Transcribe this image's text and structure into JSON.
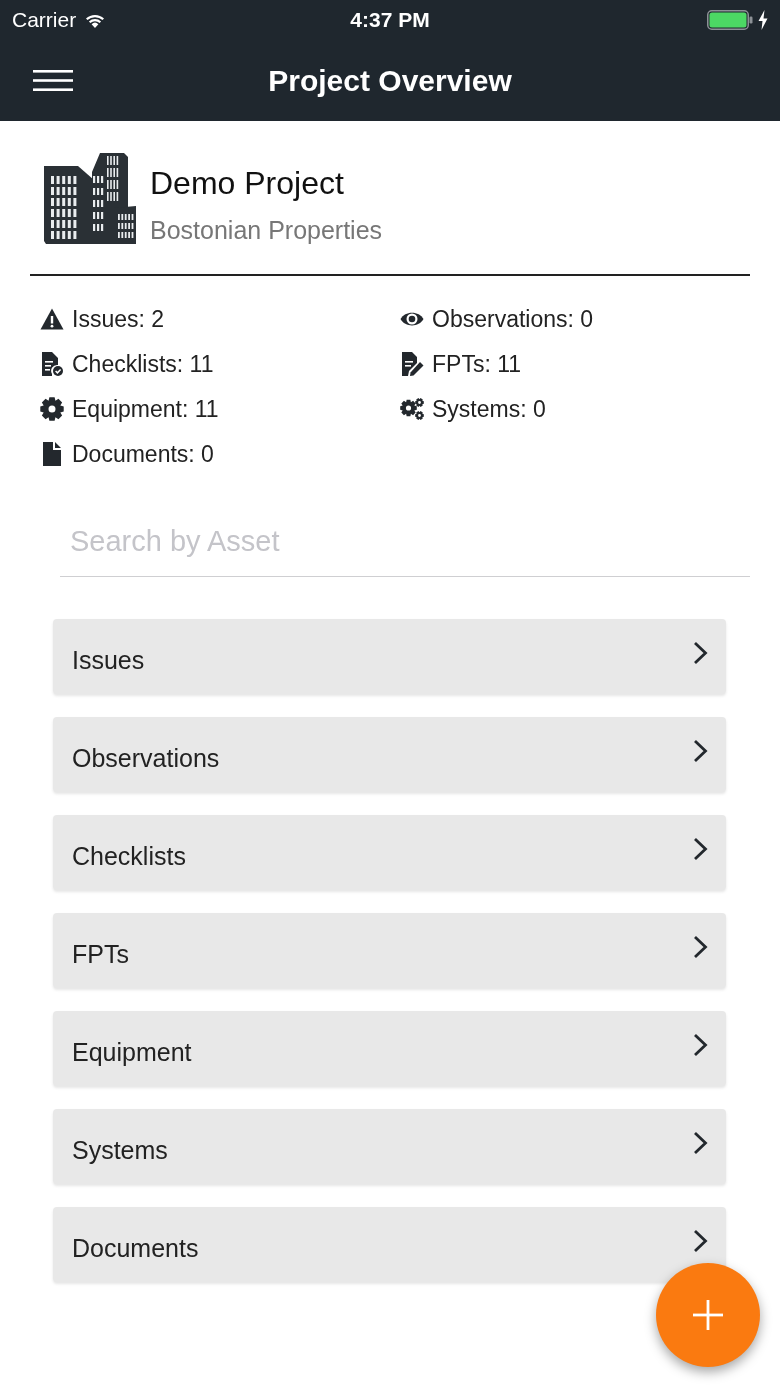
{
  "status_bar": {
    "carrier": "Carrier",
    "time": "4:37 PM"
  },
  "nav_bar": {
    "title": "Project Overview"
  },
  "project": {
    "name": "Demo Project",
    "company": "Bostonian Properties"
  },
  "stats": [
    {
      "kind": "warning",
      "label": "Issues: 2"
    },
    {
      "kind": "eye",
      "label": "Observations: 0"
    },
    {
      "kind": "checklist",
      "label": "Checklists: 11"
    },
    {
      "kind": "edit",
      "label": "FPTs: 11"
    },
    {
      "kind": "gear",
      "label": "Equipment: 11"
    },
    {
      "kind": "gears",
      "label": "Systems: 0"
    },
    {
      "kind": "document",
      "label": "Documents: 0"
    }
  ],
  "search": {
    "placeholder": "Search by Asset"
  },
  "menu": [
    {
      "label": "Issues"
    },
    {
      "label": "Observations"
    },
    {
      "label": "Checklists"
    },
    {
      "label": "FPTs"
    },
    {
      "label": "Equipment"
    },
    {
      "label": "Systems"
    },
    {
      "label": "Documents"
    }
  ]
}
